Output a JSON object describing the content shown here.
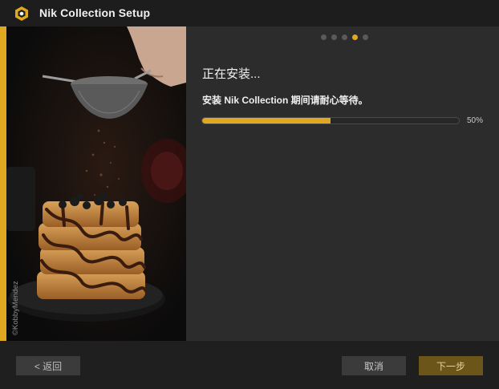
{
  "window": {
    "title": "Nik Collection Setup",
    "icon": "nik-logo-icon"
  },
  "hero": {
    "credit": "©KobbyMendez",
    "description_icon": "waffles-photo"
  },
  "steps": {
    "total": 5,
    "current": 4
  },
  "install": {
    "heading": "正在安装...",
    "message": "安装 Nik Collection 期间请耐心等待。",
    "progress_fraction": 0.5,
    "progress_label": "50%"
  },
  "footer": {
    "back_label": "< 返回",
    "cancel_label": "取消",
    "next_label": "下一步"
  },
  "colors": {
    "accent": "#e0a720",
    "background": "#2c2c2c",
    "titlebar": "#1d1d1d"
  }
}
